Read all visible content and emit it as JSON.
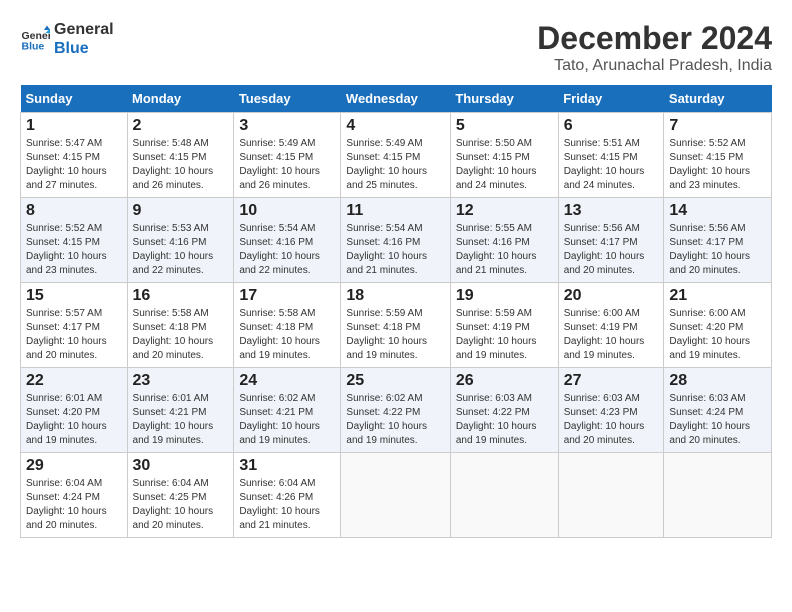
{
  "header": {
    "logo_line1": "General",
    "logo_line2": "Blue",
    "title": "December 2024",
    "subtitle": "Tato, Arunachal Pradesh, India"
  },
  "weekdays": [
    "Sunday",
    "Monday",
    "Tuesday",
    "Wednesday",
    "Thursday",
    "Friday",
    "Saturday"
  ],
  "weeks": [
    [
      {
        "day": "1",
        "sunrise": "5:47 AM",
        "sunset": "4:15 PM",
        "daylight": "10 hours and 27 minutes."
      },
      {
        "day": "2",
        "sunrise": "5:48 AM",
        "sunset": "4:15 PM",
        "daylight": "10 hours and 26 minutes."
      },
      {
        "day": "3",
        "sunrise": "5:49 AM",
        "sunset": "4:15 PM",
        "daylight": "10 hours and 26 minutes."
      },
      {
        "day": "4",
        "sunrise": "5:49 AM",
        "sunset": "4:15 PM",
        "daylight": "10 hours and 25 minutes."
      },
      {
        "day": "5",
        "sunrise": "5:50 AM",
        "sunset": "4:15 PM",
        "daylight": "10 hours and 24 minutes."
      },
      {
        "day": "6",
        "sunrise": "5:51 AM",
        "sunset": "4:15 PM",
        "daylight": "10 hours and 24 minutes."
      },
      {
        "day": "7",
        "sunrise": "5:52 AM",
        "sunset": "4:15 PM",
        "daylight": "10 hours and 23 minutes."
      }
    ],
    [
      {
        "day": "8",
        "sunrise": "5:52 AM",
        "sunset": "4:15 PM",
        "daylight": "10 hours and 23 minutes."
      },
      {
        "day": "9",
        "sunrise": "5:53 AM",
        "sunset": "4:16 PM",
        "daylight": "10 hours and 22 minutes."
      },
      {
        "day": "10",
        "sunrise": "5:54 AM",
        "sunset": "4:16 PM",
        "daylight": "10 hours and 22 minutes."
      },
      {
        "day": "11",
        "sunrise": "5:54 AM",
        "sunset": "4:16 PM",
        "daylight": "10 hours and 21 minutes."
      },
      {
        "day": "12",
        "sunrise": "5:55 AM",
        "sunset": "4:16 PM",
        "daylight": "10 hours and 21 minutes."
      },
      {
        "day": "13",
        "sunrise": "5:56 AM",
        "sunset": "4:17 PM",
        "daylight": "10 hours and 20 minutes."
      },
      {
        "day": "14",
        "sunrise": "5:56 AM",
        "sunset": "4:17 PM",
        "daylight": "10 hours and 20 minutes."
      }
    ],
    [
      {
        "day": "15",
        "sunrise": "5:57 AM",
        "sunset": "4:17 PM",
        "daylight": "10 hours and 20 minutes."
      },
      {
        "day": "16",
        "sunrise": "5:58 AM",
        "sunset": "4:18 PM",
        "daylight": "10 hours and 20 minutes."
      },
      {
        "day": "17",
        "sunrise": "5:58 AM",
        "sunset": "4:18 PM",
        "daylight": "10 hours and 19 minutes."
      },
      {
        "day": "18",
        "sunrise": "5:59 AM",
        "sunset": "4:18 PM",
        "daylight": "10 hours and 19 minutes."
      },
      {
        "day": "19",
        "sunrise": "5:59 AM",
        "sunset": "4:19 PM",
        "daylight": "10 hours and 19 minutes."
      },
      {
        "day": "20",
        "sunrise": "6:00 AM",
        "sunset": "4:19 PM",
        "daylight": "10 hours and 19 minutes."
      },
      {
        "day": "21",
        "sunrise": "6:00 AM",
        "sunset": "4:20 PM",
        "daylight": "10 hours and 19 minutes."
      }
    ],
    [
      {
        "day": "22",
        "sunrise": "6:01 AM",
        "sunset": "4:20 PM",
        "daylight": "10 hours and 19 minutes."
      },
      {
        "day": "23",
        "sunrise": "6:01 AM",
        "sunset": "4:21 PM",
        "daylight": "10 hours and 19 minutes."
      },
      {
        "day": "24",
        "sunrise": "6:02 AM",
        "sunset": "4:21 PM",
        "daylight": "10 hours and 19 minutes."
      },
      {
        "day": "25",
        "sunrise": "6:02 AM",
        "sunset": "4:22 PM",
        "daylight": "10 hours and 19 minutes."
      },
      {
        "day": "26",
        "sunrise": "6:03 AM",
        "sunset": "4:22 PM",
        "daylight": "10 hours and 19 minutes."
      },
      {
        "day": "27",
        "sunrise": "6:03 AM",
        "sunset": "4:23 PM",
        "daylight": "10 hours and 20 minutes."
      },
      {
        "day": "28",
        "sunrise": "6:03 AM",
        "sunset": "4:24 PM",
        "daylight": "10 hours and 20 minutes."
      }
    ],
    [
      {
        "day": "29",
        "sunrise": "6:04 AM",
        "sunset": "4:24 PM",
        "daylight": "10 hours and 20 minutes."
      },
      {
        "day": "30",
        "sunrise": "6:04 AM",
        "sunset": "4:25 PM",
        "daylight": "10 hours and 20 minutes."
      },
      {
        "day": "31",
        "sunrise": "6:04 AM",
        "sunset": "4:26 PM",
        "daylight": "10 hours and 21 minutes."
      },
      null,
      null,
      null,
      null
    ]
  ],
  "labels": {
    "sunrise": "Sunrise:",
    "sunset": "Sunset:",
    "daylight": "Daylight:"
  }
}
